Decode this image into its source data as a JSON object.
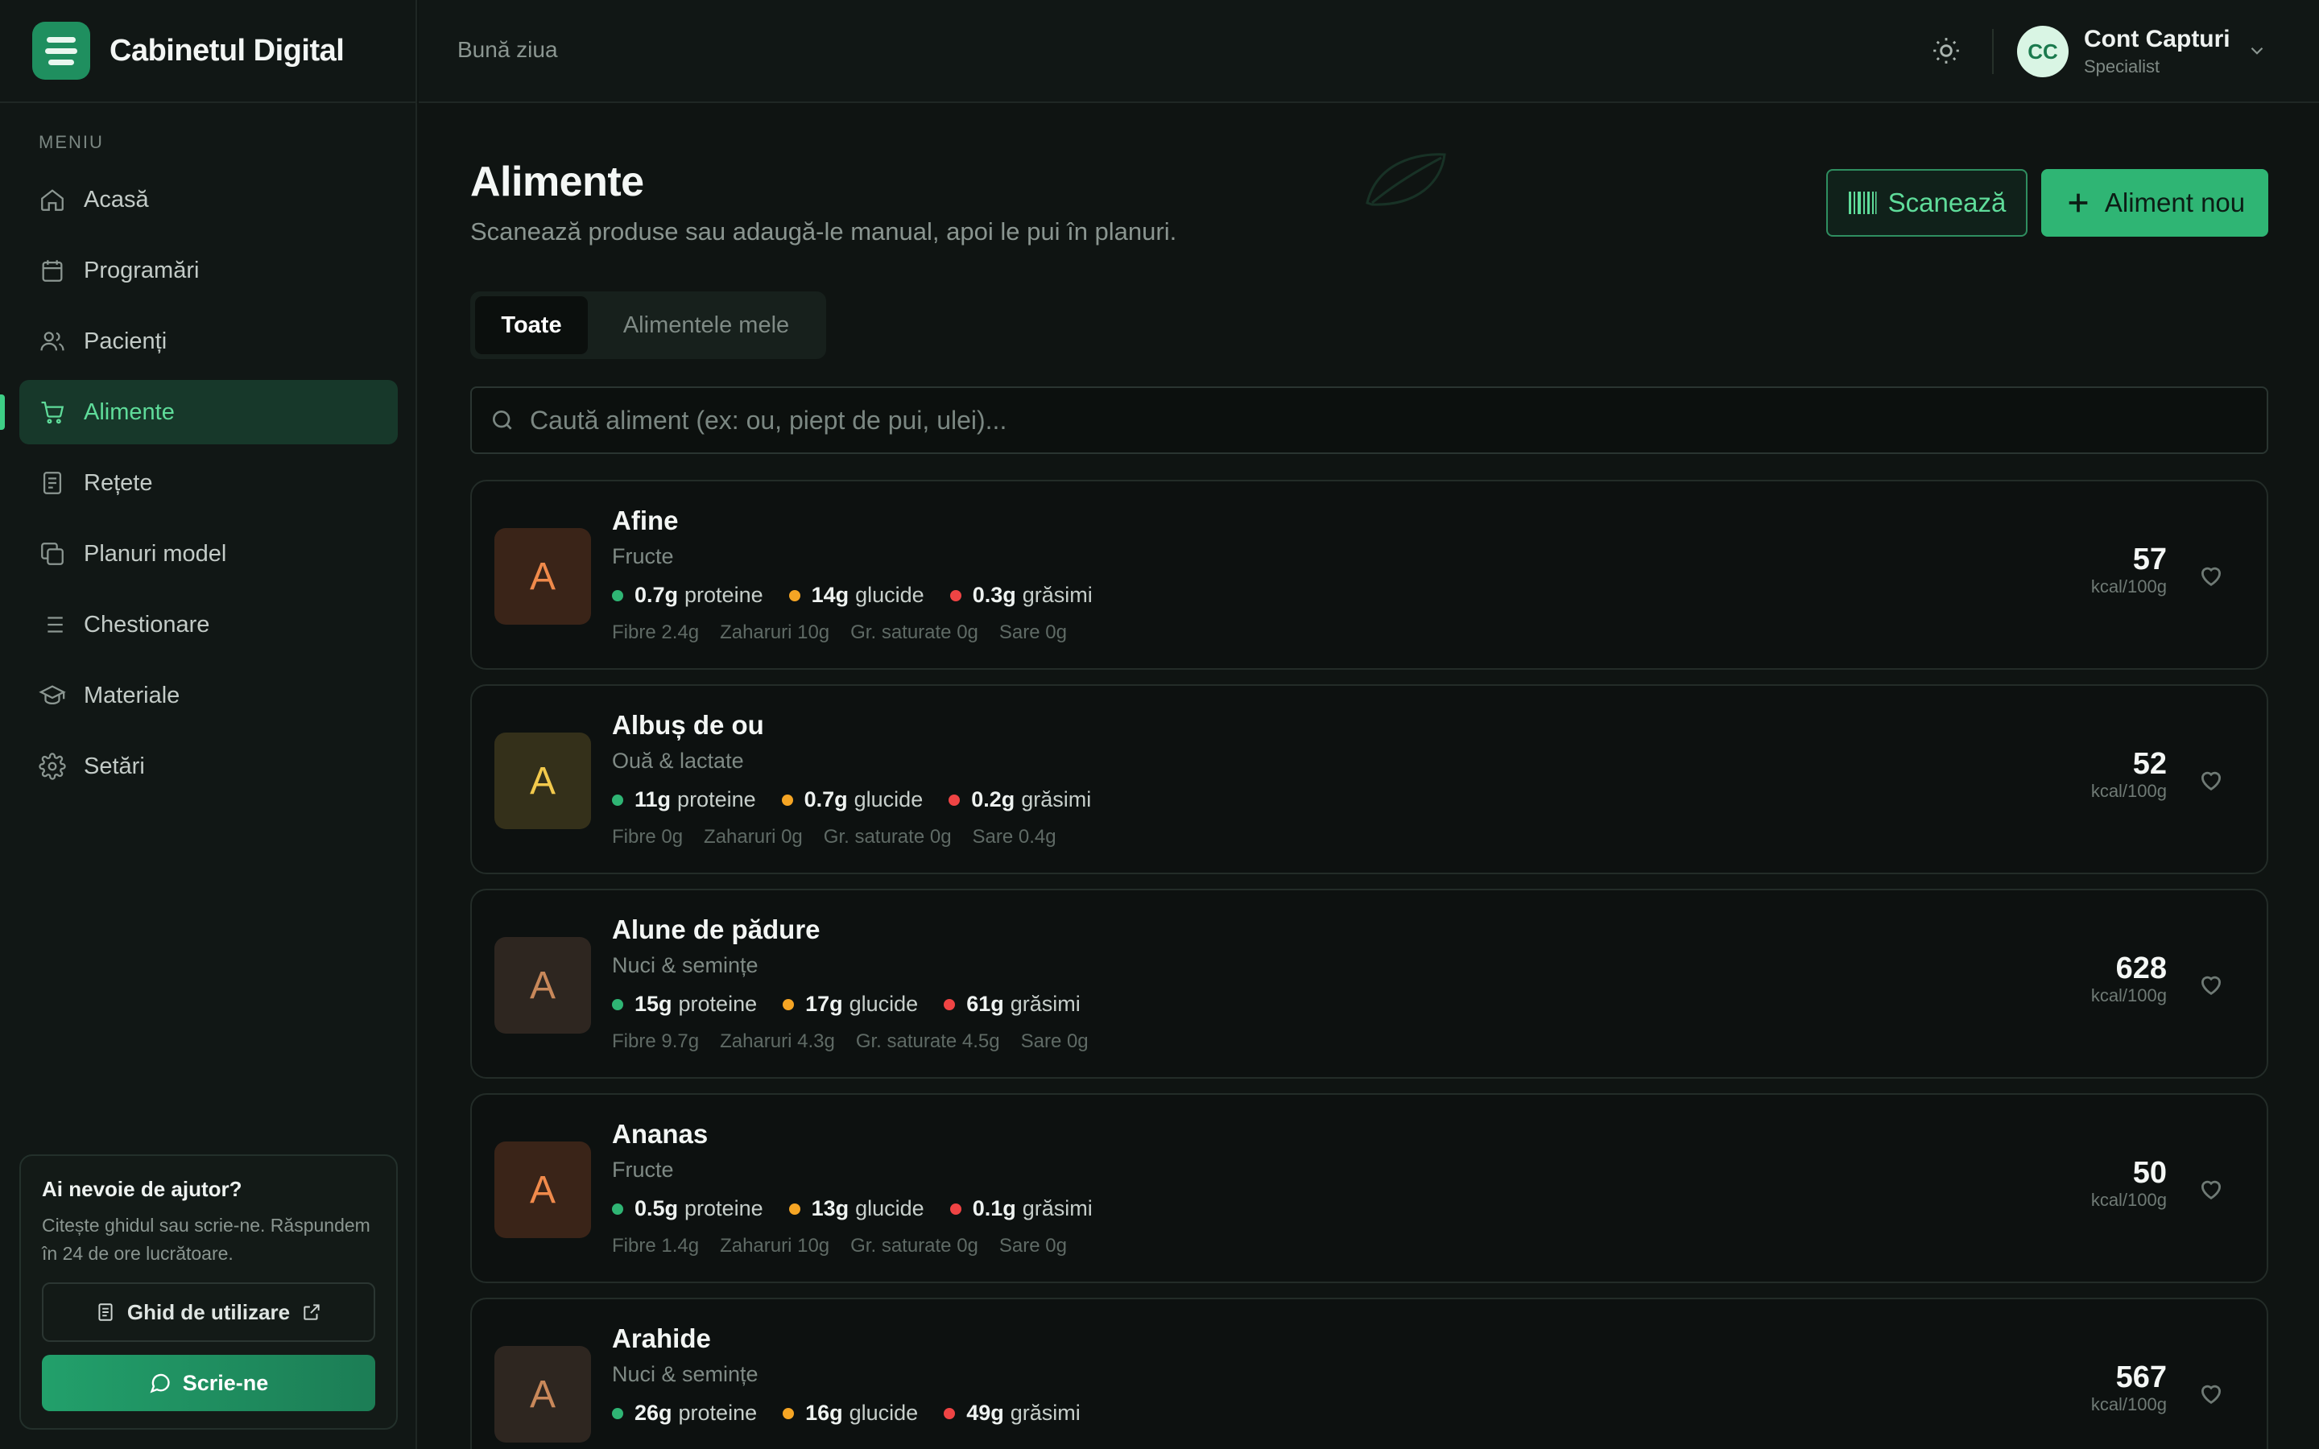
{
  "brand": {
    "name": "Cabinetul Digital"
  },
  "header": {
    "greeting": "Bună ziua",
    "user_initials": "CC",
    "user_name": "Cont Capturi",
    "user_role": "Specialist"
  },
  "sidebar": {
    "heading": "MENIU",
    "items": [
      {
        "label": "Acasă",
        "icon": "home-icon"
      },
      {
        "label": "Programări",
        "icon": "calendar-icon"
      },
      {
        "label": "Pacienți",
        "icon": "users-icon"
      },
      {
        "label": "Alimente",
        "icon": "cart-icon",
        "active": true
      },
      {
        "label": "Rețete",
        "icon": "recipe-icon"
      },
      {
        "label": "Planuri model",
        "icon": "copy-icon"
      },
      {
        "label": "Chestionare",
        "icon": "list-icon"
      },
      {
        "label": "Materiale",
        "icon": "graduation-icon"
      },
      {
        "label": "Setări",
        "icon": "gear-icon"
      }
    ],
    "help": {
      "title": "Ai nevoie de ajutor?",
      "text": "Citește ghidul sau scrie-ne. Răspundem în 24 de ore lucrătoare.",
      "guide_label": "Ghid de utilizare",
      "write_label": "Scrie-ne"
    }
  },
  "page": {
    "title": "Alimente",
    "subtitle": "Scanează produse sau adaugă-le manual, apoi le pui în planuri.",
    "scan_label": "Scanează",
    "new_label": "Aliment nou",
    "tabs": [
      {
        "label": "Toate",
        "active": true
      },
      {
        "label": "Alimentele mele",
        "active": false
      }
    ],
    "search_placeholder": "Caută aliment (ex: ou, piept de pui, ulei)..."
  },
  "colors": {
    "accent": "#2fb574",
    "protein_dot": "#2fb574",
    "carb_dot": "#f5a524",
    "fat_dot": "#ef4444"
  },
  "foods": [
    {
      "letter": "A",
      "name": "Afine",
      "category": "Fructe",
      "protein": "0.7g",
      "carbs": "14g",
      "fat": "0.3g",
      "fibre": "Fibre 2.4g",
      "sugar": "Zaharuri 10g",
      "sat": "Gr. saturate 0g",
      "salt": "Sare 0g",
      "kcal": "57",
      "avatar_bg": "#3a2418",
      "avatar_fg": "#f08a4b"
    },
    {
      "letter": "A",
      "name": "Albuș de ou",
      "category": "Ouă & lactate",
      "protein": "11g",
      "carbs": "0.7g",
      "fat": "0.2g",
      "fibre": "Fibre 0g",
      "sugar": "Zaharuri 0g",
      "sat": "Gr. saturate 0g",
      "salt": "Sare 0.4g",
      "kcal": "52",
      "avatar_bg": "#34301a",
      "avatar_fg": "#f2c94c"
    },
    {
      "letter": "A",
      "name": "Alune de pădure",
      "category": "Nuci & semințe",
      "protein": "15g",
      "carbs": "17g",
      "fat": "61g",
      "fibre": "Fibre 9.7g",
      "sugar": "Zaharuri 4.3g",
      "sat": "Gr. saturate 4.5g",
      "salt": "Sare 0g",
      "kcal": "628",
      "avatar_bg": "#2e2620",
      "avatar_fg": "#c9885a"
    },
    {
      "letter": "A",
      "name": "Ananas",
      "category": "Fructe",
      "protein": "0.5g",
      "carbs": "13g",
      "fat": "0.1g",
      "fibre": "Fibre 1.4g",
      "sugar": "Zaharuri 10g",
      "sat": "Gr. saturate 0g",
      "salt": "Sare 0g",
      "kcal": "50",
      "avatar_bg": "#3a2418",
      "avatar_fg": "#f08a4b"
    },
    {
      "letter": "A",
      "name": "Arahide",
      "category": "Nuci & semințe",
      "protein": "26g",
      "carbs": "16g",
      "fat": "49g",
      "fibre": "",
      "sugar": "",
      "sat": "",
      "salt": "",
      "kcal": "567",
      "avatar_bg": "#2e2620",
      "avatar_fg": "#c9885a"
    }
  ],
  "labels": {
    "protein": "proteine",
    "carbs": "glucide",
    "fat": "grăsimi",
    "kcal_unit": "kcal/100g"
  }
}
